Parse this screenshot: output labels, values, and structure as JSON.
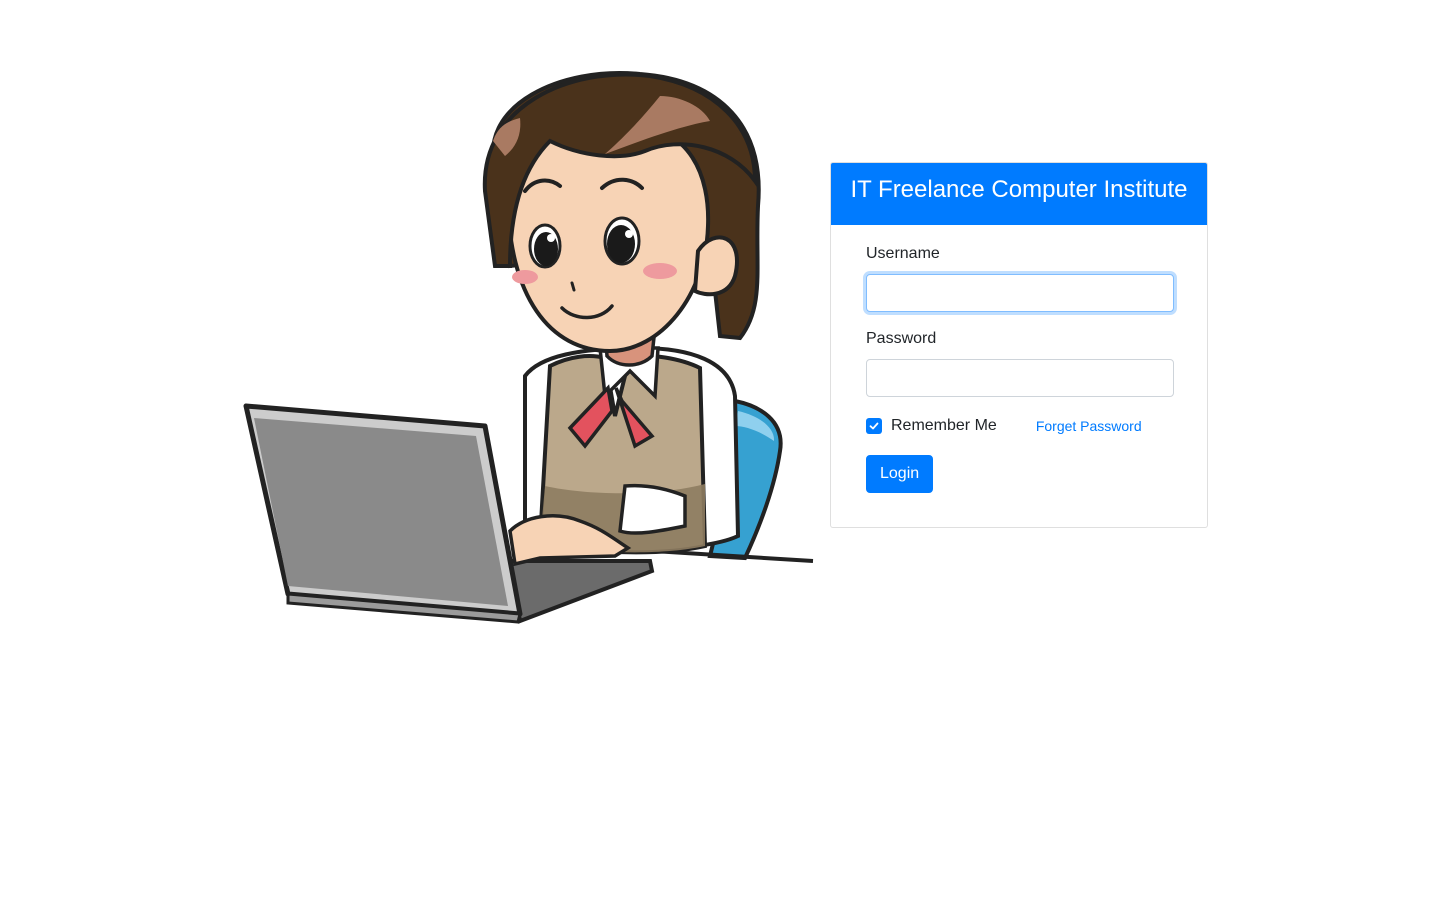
{
  "header": {
    "title": "IT Freelance Computer Institute"
  },
  "form": {
    "username_label": "Username",
    "username_value": "",
    "password_label": "Password",
    "password_value": "",
    "remember_label": "Remember Me",
    "remember_checked": true,
    "forget_label": "Forget Password",
    "login_label": "Login"
  },
  "illustration": {
    "icon": "woman-using-laptop-illustration"
  },
  "colors": {
    "primary": "#007bff",
    "text": "#212529",
    "input_border": "#ced4da"
  }
}
